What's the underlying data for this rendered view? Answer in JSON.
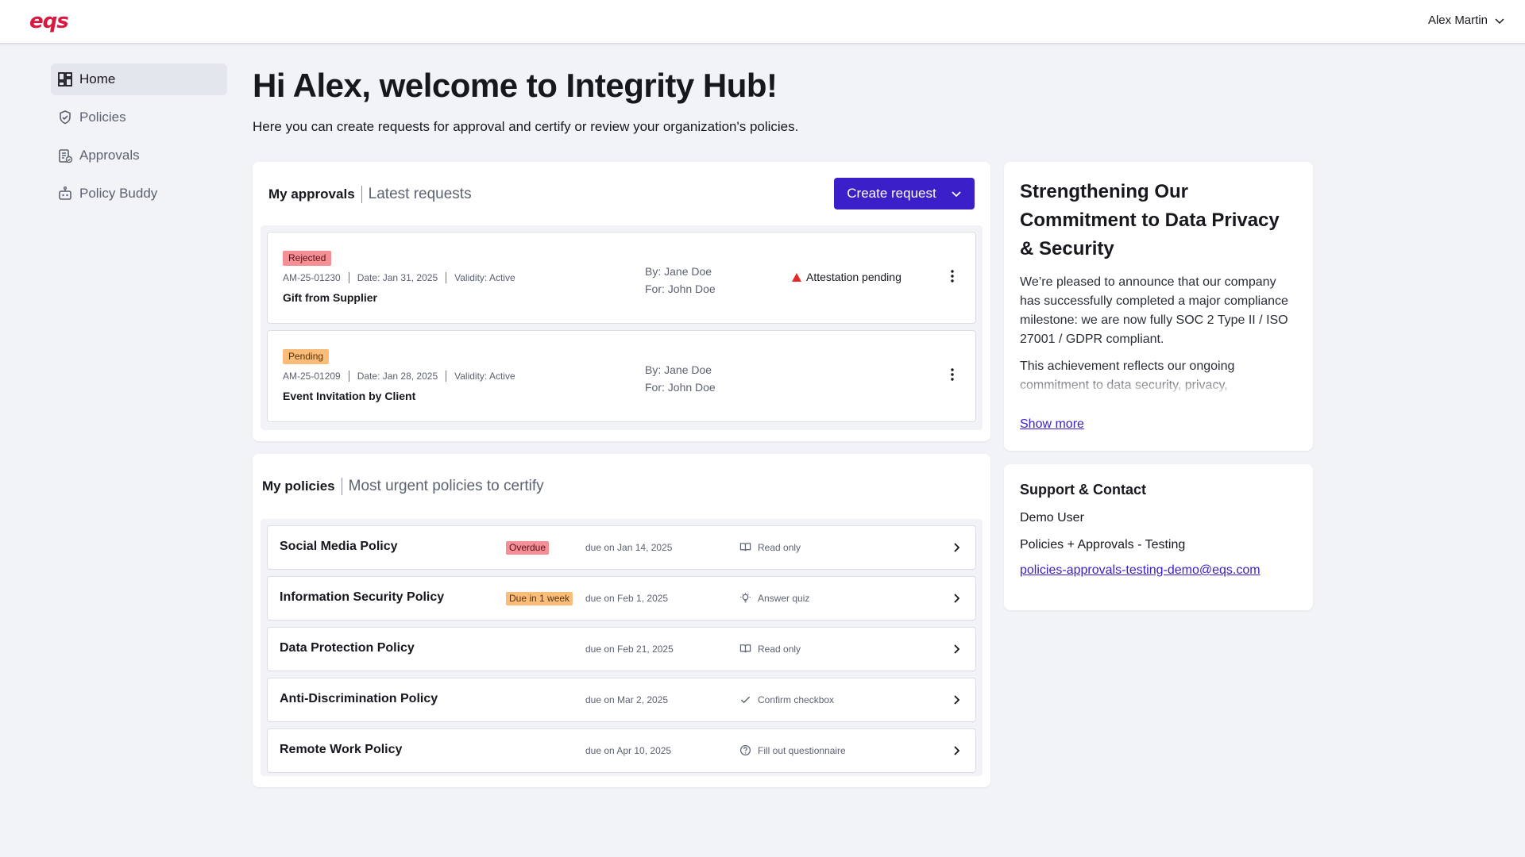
{
  "app": {
    "logo_text": "eqs",
    "brand_color": "#d8183f",
    "accent_color": "#3b1fc9"
  },
  "header": {
    "user_name": "Alex Martin",
    "user_icon": "chevron-down-icon"
  },
  "sidebar": {
    "items": [
      {
        "label": "Home",
        "icon": "dashboard-icon",
        "active": true
      },
      {
        "label": "Policies",
        "icon": "shield-check-icon",
        "active": false
      },
      {
        "label": "Approvals",
        "icon": "clipboard-check-icon",
        "active": false
      },
      {
        "label": "Policy Buddy",
        "icon": "bot-icon",
        "active": false
      }
    ]
  },
  "main": {
    "title": "Hi Alex, welcome to Integrity Hub!",
    "subtitle": "Here you can create requests for approval and certify or review your organization's policies."
  },
  "approvals": {
    "heading": "My approvals",
    "subheading": "Latest requests",
    "create_button": "Create request",
    "rows": [
      {
        "status": "Rejected",
        "id": "AM-25-01230",
        "date": "Date: Jan 31, 2025",
        "validity": "Validity: Active",
        "title": "Gift from Supplier",
        "by": "By: Jane Doe",
        "for": "For: John Doe",
        "alert": "Attestation pending"
      },
      {
        "status": "Pending",
        "id": "AM-25-01209",
        "date": "Date: Jan 28, 2025",
        "validity": "Validity: Active",
        "title": "Event Invitation by Client",
        "by": "By: Jane Doe",
        "for": "For: John Doe",
        "alert": ""
      }
    ]
  },
  "policies": {
    "heading": "My policies",
    "subheading": "Most urgent policies to certify",
    "rows": [
      {
        "name": "Social Media Policy",
        "badge": "Overdue",
        "due": "due on Jan 14, 2025",
        "action": "Read only",
        "action_icon": "book-icon"
      },
      {
        "name": "Information Security Policy",
        "badge": "Due in 1 week",
        "due": "due on Feb 1, 2025",
        "action": "Answer quiz",
        "action_icon": "lightbulb-icon"
      },
      {
        "name": "Data Protection Policy",
        "badge": "",
        "due": "due on Feb 21, 2025",
        "action": "Read only",
        "action_icon": "book-icon"
      },
      {
        "name": "Anti-Discrimination Policy",
        "badge": "",
        "due": "due on Mar 2, 2025",
        "action": "Confirm checkbox",
        "action_icon": "check-icon"
      },
      {
        "name": "Remote Work Policy",
        "badge": "",
        "due": "due on Apr 10, 2025",
        "action": "Fill out questionnaire",
        "action_icon": "question-circle-icon"
      }
    ]
  },
  "news": {
    "title": "Strengthening Our Commitment to Data Privacy & Security",
    "paragraph1": "We’re pleased to announce that our company has successfully completed a major compliance milestone: we are now fully SOC 2 Type II / ISO 27001 / GDPR compliant.",
    "paragraph2": "This achievement reflects our ongoing commitment to data security, privacy,",
    "show_more": "Show more"
  },
  "support": {
    "title": "Support & Contact",
    "user": "Demo User",
    "tenant": "Policies + Approvals - Testing",
    "email": "policies-approvals-testing-demo@eqs.com"
  }
}
